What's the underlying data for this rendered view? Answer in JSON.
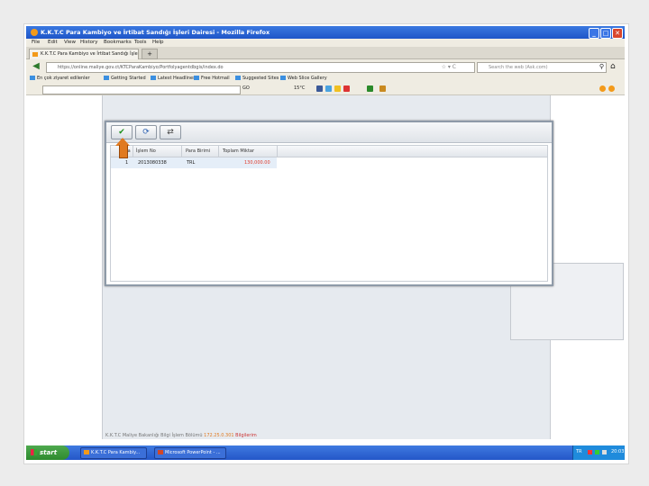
{
  "window": {
    "title": "K.K.T.C Para Kambiyo ve İrtibat Sandığı İşleri Dairesi - Mozilla Firefox",
    "minimize_glyph": "_",
    "maximize_glyph": "□",
    "close_glyph": "✕"
  },
  "menu": {
    "items": [
      "File",
      "Edit",
      "View",
      "History",
      "Bookmarks",
      "Tools",
      "Help"
    ]
  },
  "tab": {
    "label": "K.K.T.C Para Kambiyo ve İrtibat Sandığı İşle",
    "new_tab_glyph": "+"
  },
  "nav": {
    "back_glyph": "◀",
    "url": "https://online.maliye.gov.ct/KTCParaKambiyo/Portfolyagentdbgis/index.do",
    "search_placeholder": "Search the web (Ask.com)",
    "star_glyph": "☆ ▾ C",
    "search_glyph": "⚲",
    "home_glyph": "⌂"
  },
  "bookmarks": {
    "items": [
      "En çok ziyaret edilenler",
      "Getting Started",
      "Latest Headlines",
      "Free Hotmail",
      "Suggested Sites",
      "Web Slice Gallery"
    ]
  },
  "toolbar2": {
    "go_label": "GO",
    "temperature": "15°C"
  },
  "dialog": {
    "buttons": [
      {
        "name": "confirm",
        "glyph": "✔"
      },
      {
        "name": "refresh",
        "glyph": "⟳"
      },
      {
        "name": "transfer",
        "glyph": "⇄"
      }
    ],
    "columns": [
      "Sıra",
      "İşlem No",
      "Para Birimi",
      "Toplam Miktar"
    ],
    "rows": [
      {
        "index": "1",
        "islem_no": "2013080338",
        "para_birimi": "TRL",
        "toplam_miktar": "130,000.00"
      }
    ]
  },
  "footer": {
    "prefix": "K.K.T.C Maliye Bakanlığı Bilgi İşlem Bölümü",
    "ip": "172.25.0.301",
    "link": "Bilgilerim"
  },
  "taskbar": {
    "start_label": "start",
    "tasks": [
      "K.K.T.C Para Kambiy...",
      "Microsoft PowerPoint - ..."
    ],
    "tray_lang": "TR",
    "clock": "20:03"
  },
  "colors": {
    "titlebar": "#1e55c8",
    "highlight_arrow": "#e07a20",
    "amount_red": "#e03a2a",
    "taskbar": "#2456c8",
    "start_green": "#2e8a2e"
  }
}
